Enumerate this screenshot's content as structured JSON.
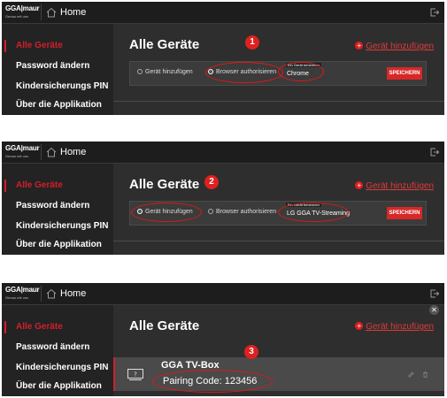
{
  "colors": {
    "accent_red": "#d21f2a",
    "panel_bg": "#2b2b2b",
    "sidebar_bg": "#232323",
    "topbar_bg": "#1d1d1d"
  },
  "header": {
    "logo_main": "GGA|maur",
    "logo_sub": "Genau mit uns",
    "home_label": "Home"
  },
  "sidebar": {
    "items": [
      {
        "label": "Alle Geräte",
        "active": true
      },
      {
        "label": "Password ändern"
      },
      {
        "label": "Kindersicherungs PIN"
      },
      {
        "label": "Über die Applikation"
      }
    ]
  },
  "main": {
    "title": "Alle Geräte",
    "add_link": "Gerät hinzufügen"
  },
  "form": {
    "radio_add": "Gerät hinzufügen",
    "radio_browser": "Browser authorisieren",
    "field_label": "Ein Gerät benennen",
    "save_button": "SPEICHERN"
  },
  "steps": [
    {
      "number": "1",
      "field_value": "Chrome"
    },
    {
      "number": "2",
      "field_value": "LG  GGA TV-Streaming"
    },
    {
      "number": "3"
    }
  ],
  "device": {
    "name": "GGA TV-Box",
    "pairing_code": "Pairing Code: 123456",
    "icon": "tv-box-icon"
  },
  "icons": {
    "home": "home-icon",
    "exit": "logout-icon",
    "edit": "edit-icon",
    "delete": "trash-icon",
    "close": "close-icon"
  }
}
